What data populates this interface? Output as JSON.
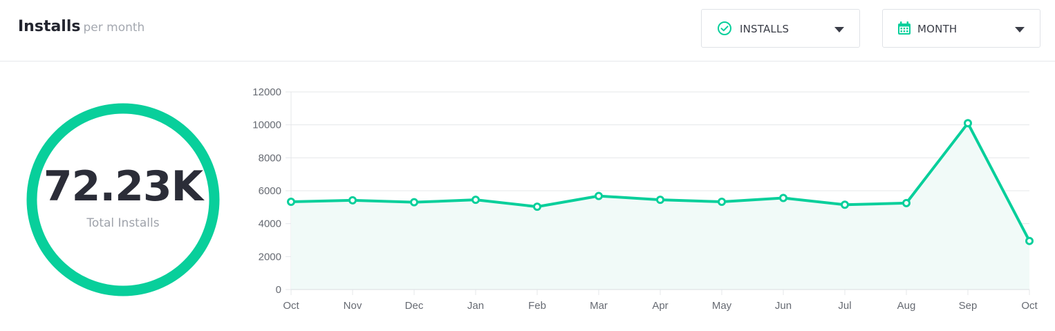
{
  "header": {
    "title": "Installs",
    "subtitle": "per month",
    "metric_dropdown": {
      "label": "INSTALLS",
      "icon": "check-circle-icon"
    },
    "period_dropdown": {
      "label": "MONTH",
      "icon": "calendar-icon"
    }
  },
  "summary": {
    "value": "72.23K",
    "label": "Total Installs"
  },
  "colors": {
    "accent": "#08cf9b",
    "area_fill": "#f1faf8",
    "grid": "#e5e7ea"
  },
  "chart_data": {
    "type": "area",
    "categories": [
      "Oct",
      "Nov",
      "Dec",
      "Jan",
      "Feb",
      "Mar",
      "Apr",
      "May",
      "Jun",
      "Jul",
      "Aug",
      "Sep",
      "Oct"
    ],
    "series": [
      {
        "values": [
          5330,
          5420,
          5300,
          5450,
          5030,
          5680,
          5450,
          5330,
          5560,
          5150,
          5250,
          10100,
          2950
        ]
      }
    ],
    "title": "",
    "xlabel": "",
    "ylabel": "",
    "ylim": [
      0,
      12000
    ],
    "yticks": [
      "0",
      "2000",
      "4000",
      "6000",
      "8000",
      "10000",
      "12000"
    ],
    "grid": true,
    "legend": "none"
  }
}
